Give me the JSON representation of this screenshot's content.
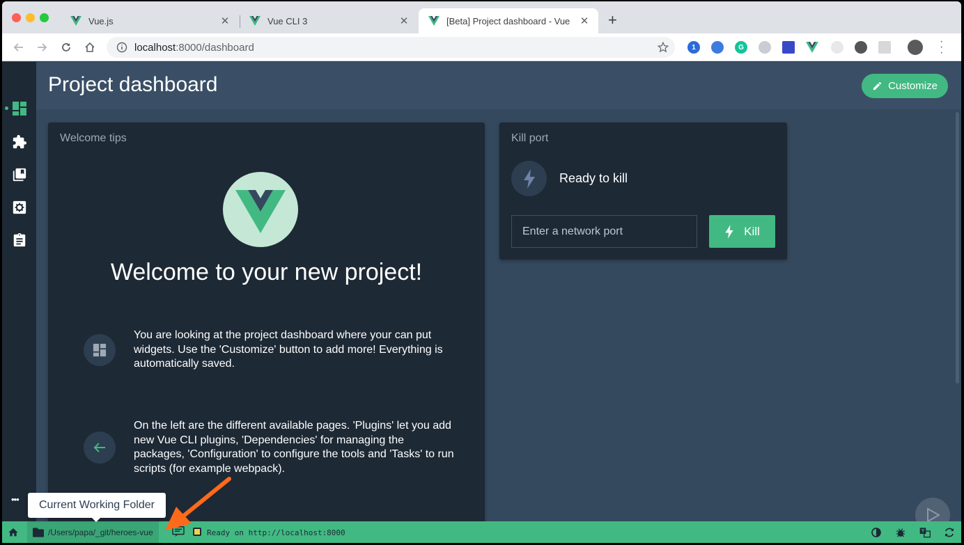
{
  "browser": {
    "tabs": [
      {
        "label": "Vue.js",
        "active": false
      },
      {
        "label": "Vue CLI 3",
        "active": false
      },
      {
        "label": "[Beta] Project dashboard - Vue",
        "active": true
      }
    ],
    "close_glyph": "✕",
    "new_tab_glyph": "+",
    "url_host": "localhost",
    "url_path": ":8000/dashboard",
    "extensions": [
      "1password-icon",
      "extension-icon",
      "grammarly-icon",
      "extension-icon",
      "extension-icon",
      "vue-devtools-icon",
      "extension-icon",
      "extension-icon",
      "extension-icon"
    ]
  },
  "sidebar": {
    "items": [
      {
        "name": "dashboard-icon",
        "active": true
      },
      {
        "name": "plugins-icon",
        "active": false
      },
      {
        "name": "dependencies-icon",
        "active": false
      },
      {
        "name": "configuration-icon",
        "active": false
      },
      {
        "name": "tasks-icon",
        "active": false
      }
    ],
    "more_glyph": "•••"
  },
  "header": {
    "title": "Project dashboard",
    "customize_label": "Customize"
  },
  "welcome_card": {
    "title": "Welcome tips",
    "heading": "Welcome to your new project!",
    "tips": [
      {
        "icon": "widgets-icon",
        "text": "You are looking at the project dashboard where your can put widgets. Use the 'Customize' button to add more! Everything is automatically saved."
      },
      {
        "icon": "arrow-left-icon",
        "text": "On the left are the different available pages. 'Plugins' let you add new Vue CLI plugins, 'Dependencies' for managing the packages, 'Configuration' to configure the tools and 'Tasks' to run scripts (for example webpack)."
      }
    ]
  },
  "kill_card": {
    "title": "Kill port",
    "status": "Ready to kill",
    "input_placeholder": "Enter a network port",
    "button_label": "Kill"
  },
  "tooltip": {
    "text": "Current Working Folder"
  },
  "statusbar": {
    "folder_path": "/Users/papa/_git/heroes-vue",
    "log_text": "Ready on http://localhost:8000"
  },
  "colors": {
    "accent": "#42b983",
    "sidebar_bg": "#1d2935",
    "main_bg": "#35495e",
    "card_bg": "#1d2935",
    "annotation_arrow": "#ff6a1a"
  }
}
